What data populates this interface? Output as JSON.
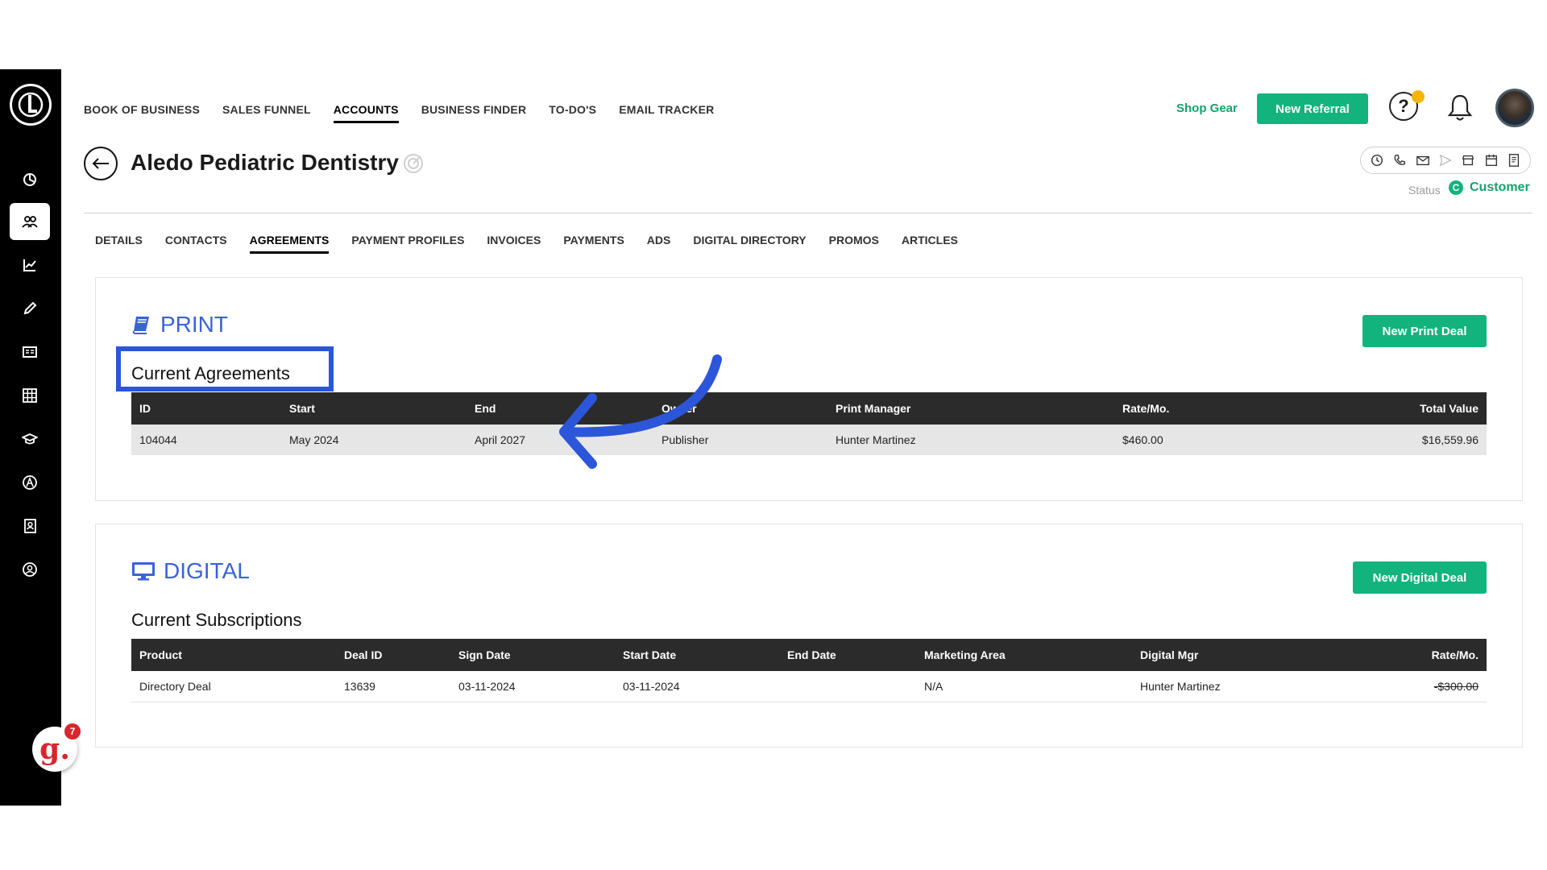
{
  "nav": {
    "items": [
      "BOOK OF BUSINESS",
      "SALES FUNNEL",
      "ACCOUNTS",
      "BUSINESS FINDER",
      "TO-DO'S",
      "EMAIL TRACKER"
    ],
    "active": "ACCOUNTS",
    "shop_gear": "Shop Gear",
    "new_referral": "New Referral",
    "help_glyph": "?"
  },
  "sidebar": {
    "icons": [
      "dashboard-icon",
      "accounts-icon",
      "analytics-icon",
      "pen-icon",
      "newspaper-icon",
      "grid-icon",
      "graduation-cap-icon",
      "a-circle-icon",
      "contact-book-icon",
      "user-circle-icon"
    ],
    "active": "accounts-icon",
    "assistant_glyph": "g.",
    "assistant_badge": "7"
  },
  "account": {
    "name": "Aledo Pediatric Dentistry",
    "status_label": "Status",
    "status_badge_letter": "C",
    "status_value": "Customer"
  },
  "tabs": [
    "DETAILS",
    "CONTACTS",
    "AGREEMENTS",
    "PAYMENT PROFILES",
    "INVOICES",
    "PAYMENTS",
    "ADS",
    "DIGITAL DIRECTORY",
    "PROMOS",
    "ARTICLES"
  ],
  "active_tab": "AGREEMENTS",
  "print": {
    "title": "PRINT",
    "button": "New Print Deal",
    "subtitle": "Current Agreements",
    "columns": [
      "ID",
      "Start",
      "End",
      "Owner",
      "Print Manager",
      "Rate/Mo.",
      "Total Value"
    ],
    "rows": [
      [
        "104044",
        "May 2024",
        "April 2027",
        "Publisher",
        "Hunter Martinez",
        "$460.00",
        "$16,559.96"
      ]
    ]
  },
  "digital": {
    "title": "DIGITAL",
    "button": "New Digital Deal",
    "subtitle": "Current Subscriptions",
    "columns": [
      "Product",
      "Deal ID",
      "Sign Date",
      "Start Date",
      "End Date",
      "Marketing Area",
      "Digital Mgr",
      "Rate/Mo."
    ],
    "rows": [
      [
        "Directory Deal",
        "13639",
        "03-11-2024",
        "03-11-2024",
        "",
        "N/A",
        "Hunter Martinez",
        "-$300.00"
      ]
    ]
  },
  "colors": {
    "accent_green": "#12b37c",
    "link_blue": "#3b63d6",
    "annotation_blue": "#2c56d9",
    "sidebar": "#000000"
  }
}
